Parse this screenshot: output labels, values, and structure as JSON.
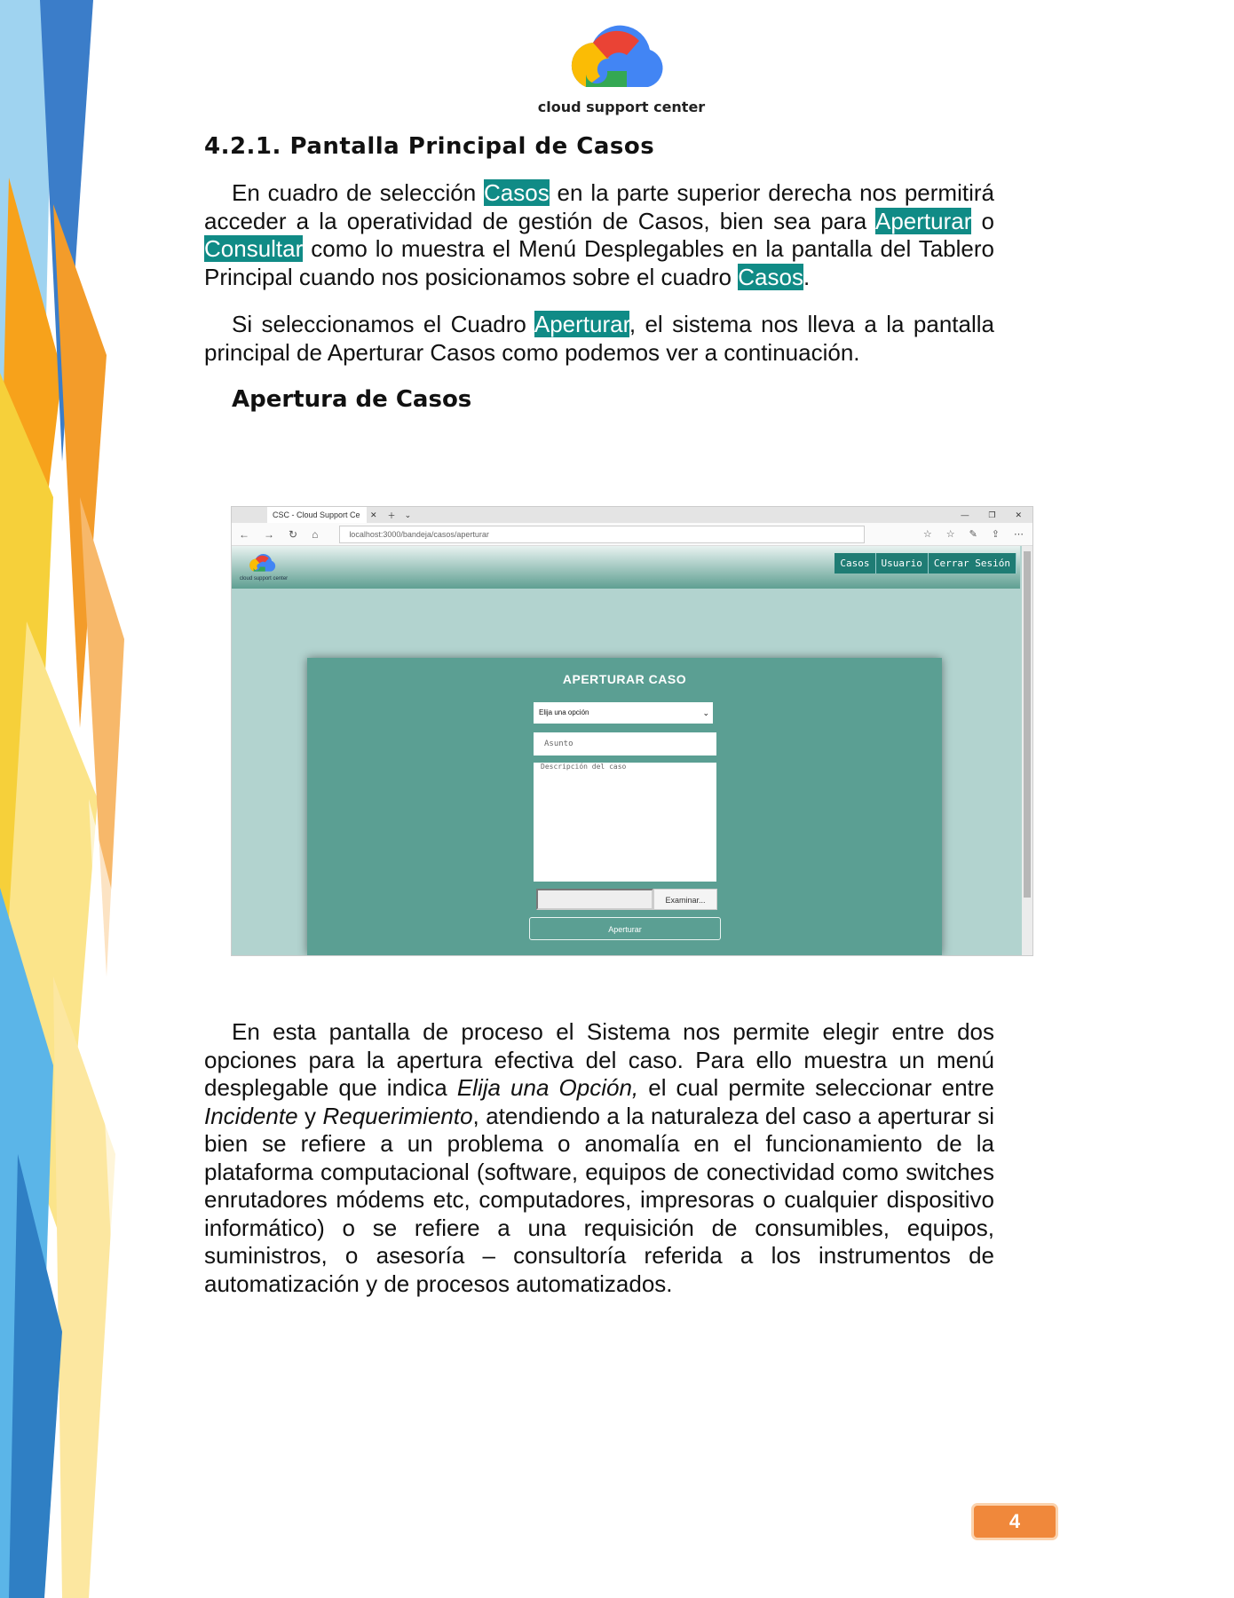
{
  "logo": {
    "text": "cloud support center"
  },
  "section": {
    "title": "4.2.1.  Pantalla Principal de Casos",
    "p1": {
      "t1": "En cuadro de selección ",
      "h1": "Casos",
      "t2": " en la parte superior derecha nos permitirá acceder a la operatividad de gestión de Casos, bien sea para ",
      "h2": "Aperturar",
      "t3": " o ",
      "h3": "Consultar",
      "t4": " como lo muestra el Menú Desplegables en la pantalla del Tablero Principal cuando nos posicionamos sobre el cuadro ",
      "h4": "Casos",
      "t5": "."
    },
    "p2": {
      "t1": "Si seleccionamos el Cuadro ",
      "h1": "Aperturar",
      "t2": ", el sistema nos lleva a la pantalla principal de Aperturar Casos como podemos ver a continuación."
    },
    "subtitle": "Apertura de Casos",
    "p3": {
      "t1": "En esta pantalla de proceso el Sistema nos permite elegir entre dos opciones para la apertura efectiva del caso. Para ello muestra un menú desplegable que indica ",
      "i1": "Elija una Opción,",
      "t2": " el cual permite seleccionar entre ",
      "i2": "Incidente",
      "t3": " y ",
      "i3": "Requerimiento",
      "t4": ", atendiendo a la naturaleza del caso a aperturar si bien se refiere a un problema o anomalía en el funcionamiento de la plataforma computacional (software, equipos de conectividad como switches enrutadores módems etc, computadores, impresoras o cualquier dispositivo informático) o se refiere a una requisición de consumibles, equipos, suministros, o asesoría – consultoría referida a los instrumentos de automatización y de procesos automatizados."
    }
  },
  "screenshot": {
    "tab_title": "CSC - Cloud Support Ce",
    "url": "localhost:3000/bandeja/casos/aperturar",
    "app_logo_text": "cloud support center",
    "menu": [
      "Casos",
      "Usuario",
      "Cerrar Sesión"
    ],
    "card_title": "APERTURAR  CASO",
    "select_value": "Elija una opción",
    "subject_placeholder": "Asunto",
    "description_placeholder": "Descripción del caso",
    "browse_label": "Examinar...",
    "submit_label": "Aperturar"
  },
  "page_number": "4",
  "colors": {
    "highlight": "#108b86",
    "header": "#1f7c74",
    "card": "#5b9f93",
    "page_badge": "#f0883b"
  }
}
